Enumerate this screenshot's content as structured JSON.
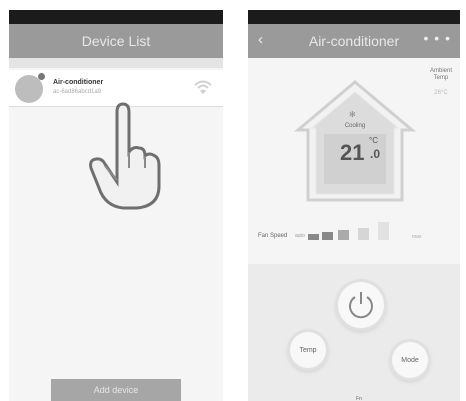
{
  "device_list_screen": {
    "title": "Device List",
    "device": {
      "name": "Air-conditioner",
      "id": "ac-6ad86abcd1a9"
    },
    "add_button_label": "Add device"
  },
  "ac_screen": {
    "title": "Air-conditioner",
    "back_icon": "‹",
    "more_icon": "• • •",
    "ambient_label": "Ambient Temp",
    "ambient_value": "26°C",
    "mode": "Cooling",
    "temperature": "21",
    "temperature_decimal": ".0",
    "temperature_unit": "°C",
    "fan_speed_label": "Fan Speed",
    "fan_low_label": "auto",
    "fan_high_label": "max",
    "buttons": {
      "temp": "Temp",
      "mode": "Mode"
    },
    "bottom_label": "Fn"
  },
  "colors": {
    "titlebar": "#9a9a9a",
    "statusbar": "#1b1b1b",
    "add_button": "#a6a6a6"
  }
}
